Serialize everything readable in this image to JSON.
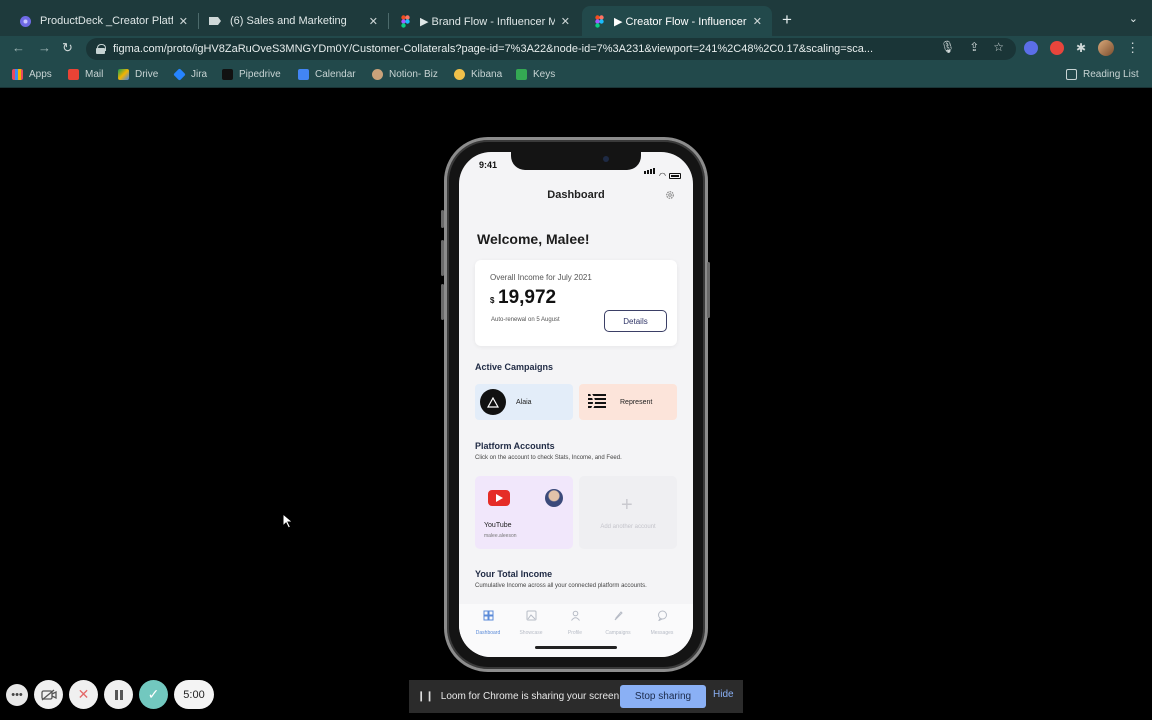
{
  "browser": {
    "tabs": [
      {
        "title": "ProductDeck _Creator Platform",
        "icon": "productdeck-icon"
      },
      {
        "title": "(6) Sales and Marketing",
        "icon": "slack-like-icon"
      },
      {
        "title": "▶ Brand Flow - Influencer Mark",
        "icon": "figma-icon"
      },
      {
        "title": "▶ Creator Flow - Influencer Ma",
        "icon": "figma-icon"
      }
    ],
    "url": "figma.com/proto/igHV8ZaRuOveS3MNGYDm0Y/Customer-Collaterals?page-id=7%3A22&node-id=7%3A231&viewport=241%2C48%2C0.17&scaling=sca...",
    "bookmarks": [
      "Apps",
      "Mail",
      "Drive",
      "Jira",
      "Pipedrive",
      "Calendar",
      "Notion- Biz",
      "Kibana",
      "Keys"
    ],
    "reading_list": "Reading List"
  },
  "phone": {
    "time": "9:41",
    "title": "Dashboard",
    "welcome": "Welcome, Malee!",
    "income": {
      "label": "Overall Income for July 2021",
      "currency": "$",
      "amount": "19,972",
      "renewal": "Auto-renewal on 5 August",
      "details": "Details"
    },
    "active_campaigns": {
      "title": "Active Campaigns",
      "items": [
        {
          "name": "Alaia"
        },
        {
          "name": "Represent"
        }
      ]
    },
    "platform_accounts": {
      "title": "Platform Accounts",
      "subtitle": "Click on the account to check Stats, Income, and Feed.",
      "account_name": "YouTube",
      "account_handle": "malee.aleeson",
      "add": "Add another account"
    },
    "total_income": {
      "title": "Your Total Income",
      "subtitle": "Cumulative Income across all your connected platform accounts."
    },
    "tabbar": [
      "Dashboard",
      "Showcase",
      "Profile",
      "Campaigns",
      "Messages"
    ]
  },
  "loom": {
    "timer": "5:00",
    "share_message": "Loom for Chrome is sharing your screen.",
    "stop": "Stop sharing",
    "hide": "Hide"
  },
  "colors": {
    "chrome_bg": "#1e3a3c",
    "toolbar_bg": "#22494b",
    "accent": "#8ab0f5"
  }
}
